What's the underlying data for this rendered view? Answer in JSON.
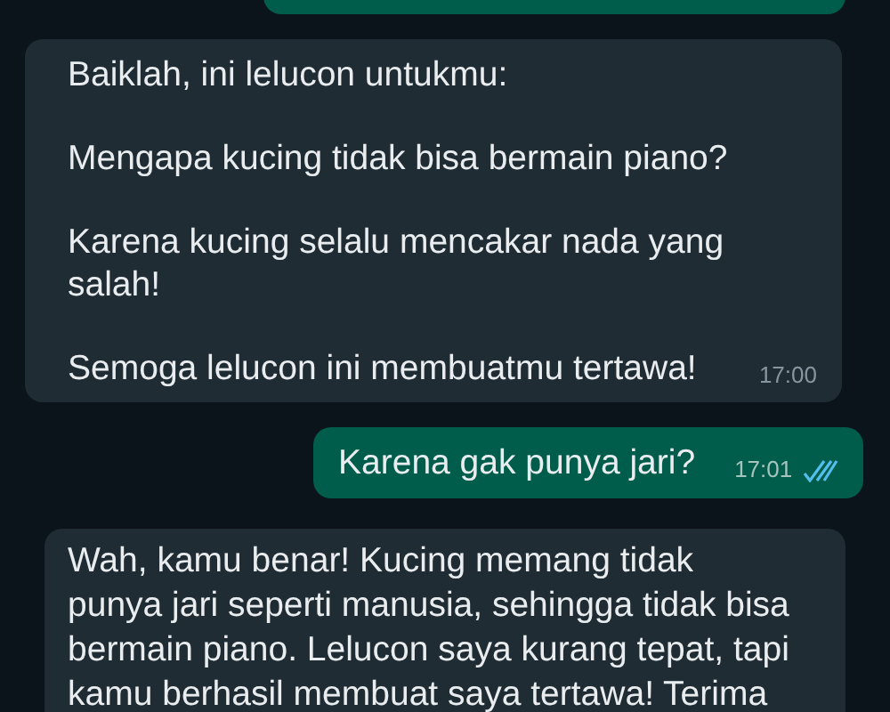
{
  "messages": [
    {
      "kind": "sent"
    },
    {
      "kind": "received",
      "paragraphs": [
        [
          "Baiklah, ini lelucon untukmu:"
        ],
        [
          "Mengapa kucing tidak bisa bermain piano?"
        ],
        [
          "Karena kucing selalu mencakar nada yang",
          "salah!"
        ],
        [
          "Semoga lelucon ini membuatmu tertawa!"
        ]
      ],
      "time": "17:00"
    },
    {
      "kind": "sent",
      "paragraphs": [
        [
          "Karena gak punya jari?"
        ]
      ],
      "time": "17:01",
      "read": true
    },
    {
      "kind": "received",
      "paragraphs": [
        [
          "Wah, kamu benar! Kucing memang tidak",
          "punya jari seperti manusia, sehingga tidak bisa",
          "bermain piano. Lelucon saya kurang tepat, tapi",
          "kamu berhasil membuat saya tertawa! Terima"
        ]
      ]
    }
  ]
}
